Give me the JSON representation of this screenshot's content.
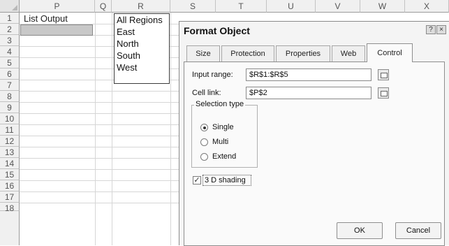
{
  "sheet": {
    "columns": [
      "P",
      "Q",
      "R",
      "S",
      "T",
      "U",
      "V",
      "W",
      "X"
    ],
    "rows": [
      "1",
      "2",
      "3",
      "4",
      "5",
      "6",
      "7",
      "8",
      "9",
      "10",
      "11",
      "12",
      "13",
      "14",
      "15",
      "16",
      "17",
      "18"
    ],
    "cell_p1": "List Output",
    "listbox_items": [
      "All Regions",
      "East",
      "North",
      "South",
      "West"
    ]
  },
  "dialog": {
    "title": "Format Object",
    "help_button": "?",
    "close_button": "×",
    "tabs": [
      "Size",
      "Protection",
      "Properties",
      "Web",
      "Control"
    ],
    "active_tab": "Control",
    "input_range_label": "Input range:",
    "input_range_value": "$R$1:$R$5",
    "cell_link_label": "Cell link:",
    "cell_link_value": "$P$2",
    "selection_type_label": "Selection type",
    "selection_options": [
      "Single",
      "Multi",
      "Extend"
    ],
    "selected_option": "Single",
    "shading_label": "3 D shading",
    "shading_checked": true,
    "ok_label": "OK",
    "cancel_label": "Cancel"
  }
}
